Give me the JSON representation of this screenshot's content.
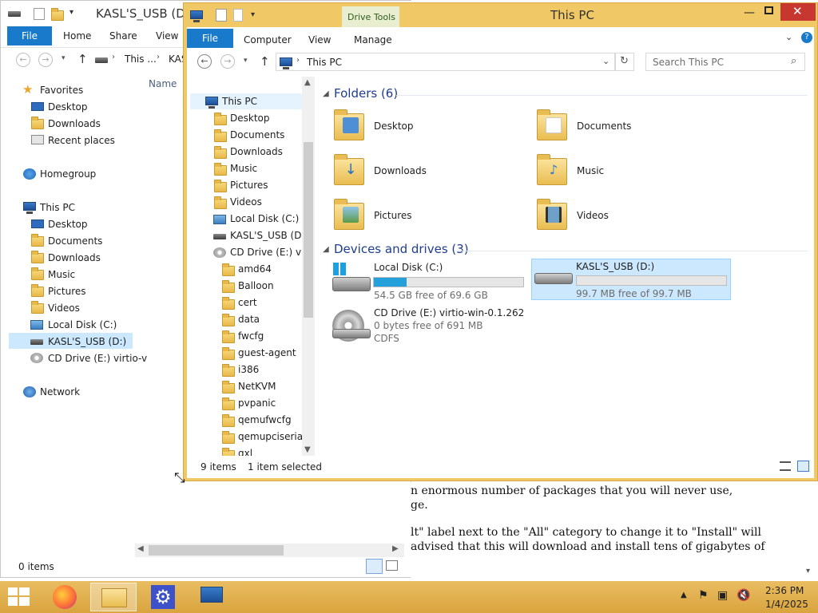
{
  "back_window": {
    "title": "KASL'S_USB (D:)",
    "tabs": [
      "File",
      "Home",
      "Share",
      "View"
    ],
    "address": [
      "This ...",
      "KAS"
    ],
    "column_name": "Name",
    "nav": {
      "favorites": "Favorites",
      "favorites_items": [
        "Desktop",
        "Downloads",
        "Recent places"
      ],
      "homegroup": "Homegroup",
      "this_pc": "This PC",
      "this_pc_items": [
        "Desktop",
        "Documents",
        "Downloads",
        "Music",
        "Pictures",
        "Videos",
        "Local Disk (C:)",
        "KASL'S_USB (D:)",
        "CD Drive (E:) virtio-v"
      ],
      "network": "Network"
    },
    "status": "0 items"
  },
  "front_window": {
    "title": "This PC",
    "contextual_tab": "Drive Tools",
    "tabs": [
      "File",
      "Computer",
      "View",
      "Manage"
    ],
    "address": "This PC",
    "search_placeholder": "Search This PC",
    "tree": {
      "root": "This PC",
      "items": [
        "Desktop",
        "Documents",
        "Downloads",
        "Music",
        "Pictures",
        "Videos",
        "Local Disk (C:)",
        "KASL'S_USB (D:)",
        "CD Drive (E:) virti"
      ],
      "cd_children": [
        "amd64",
        "Balloon",
        "cert",
        "data",
        "fwcfg",
        "guest-agent",
        "i386",
        "NetKVM",
        "pvpanic",
        "qemufwcfg",
        "qemupciserial",
        "qxl"
      ]
    },
    "folders_header": "Folders (6)",
    "folders": [
      "Desktop",
      "Documents",
      "Downloads",
      "Music",
      "Pictures",
      "Videos"
    ],
    "devices_header": "Devices and drives (3)",
    "drives": [
      {
        "name": "Local Disk (C:)",
        "detail": "54.5 GB free of 69.6 GB",
        "used_fraction": 0.22
      },
      {
        "name": "KASL'S_USB (D:)",
        "detail": "99.7 MB free of 99.7 MB",
        "used_fraction": 0.0
      },
      {
        "name": "CD Drive (E:) virtio-win-0.1.262",
        "detail": "0 bytes free of 691 MB",
        "fs": "CDFS"
      }
    ],
    "status_count": "9 items",
    "status_selected": "1 item selected"
  },
  "doc": {
    "lines": [
      "n enormous number of packages that you will never use,",
      "ge.",
      "lt\" label next to the \"All\" category to change it to \"Install\" will",
      "advised that this will download and install tens of gigabytes of"
    ]
  },
  "taskbar": {
    "time": "2:36 PM",
    "date": "1/4/2025"
  },
  "colors": {
    "accent": "#1979ca",
    "window_frame": "#f0c866",
    "selection": "#cce8ff",
    "header_text": "#1e3d8f",
    "progress": "#26a0da"
  }
}
